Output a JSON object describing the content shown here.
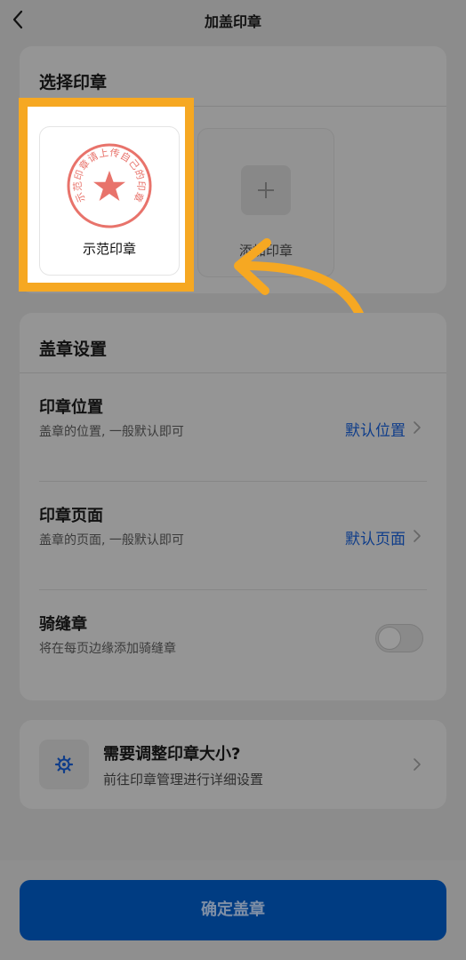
{
  "header": {
    "title": "加盖印章"
  },
  "select_seal": {
    "title": "选择印章",
    "seals": [
      {
        "label": "示范印章",
        "seal_text": "示范印章请上传自己的印章"
      }
    ],
    "add_label": "添加印章"
  },
  "settings": {
    "title": "盖章设置",
    "rows": [
      {
        "title": "印章位置",
        "desc": "盖章的位置, 一般默认即可",
        "value": "默认位置"
      },
      {
        "title": "印章页面",
        "desc": "盖章的页面, 一般默认即可",
        "value": "默认页面"
      },
      {
        "title": "骑缝章",
        "desc": "将在每页边缘添加骑缝章",
        "toggle_on": false
      }
    ]
  },
  "tip": {
    "title": "需要调整印章大小?",
    "desc": "前往印章管理进行详细设置"
  },
  "footer": {
    "confirm_label": "确定盖章"
  },
  "colors": {
    "accent_blue": "#003c82",
    "highlight_orange": "#f6a822",
    "seal_red": "#e8736b"
  }
}
